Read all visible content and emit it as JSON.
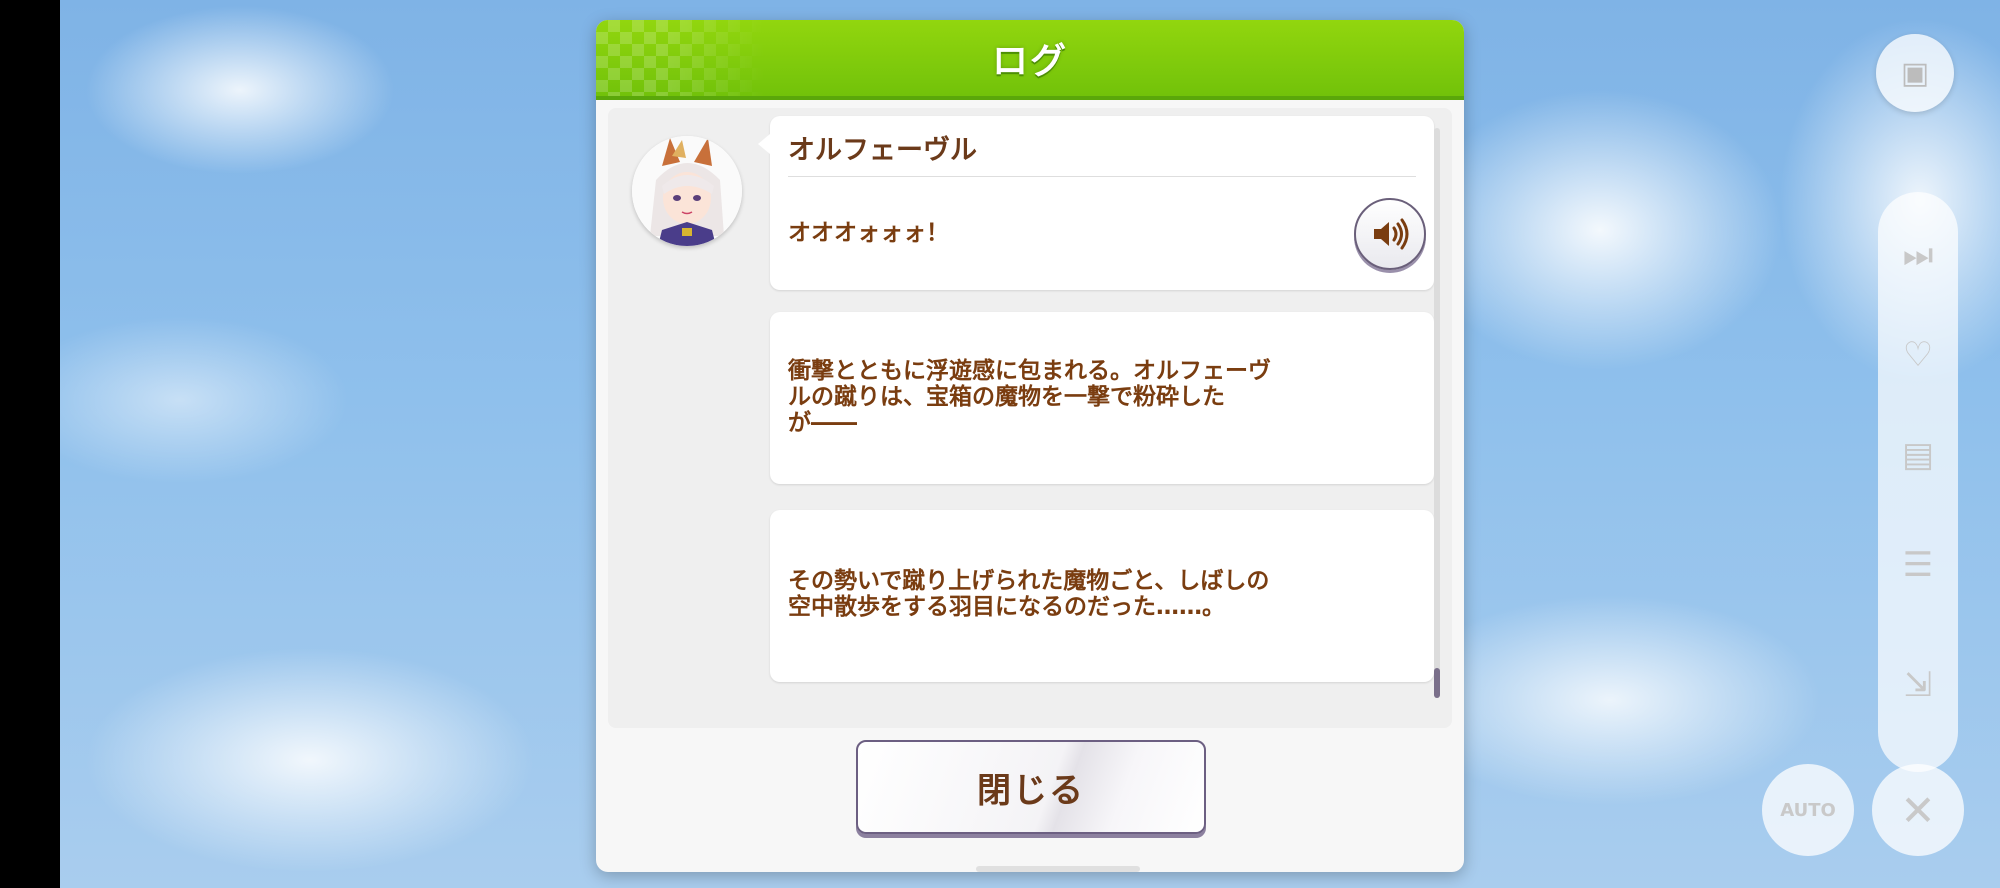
{
  "dialog": {
    "title": "ログ",
    "close_label": "閉じる"
  },
  "entries": [
    {
      "speaker": "オルフェーヴル",
      "text": "オオオォォォ！",
      "has_voice": true
    },
    {
      "speaker": "",
      "text": "衝撃とともに浮遊感に包まれる。オルフェーヴ\nルの蹴りは、宝箱の魔物を一撃で粉砕した\nが――"
    },
    {
      "speaker": "",
      "text": "その勢いで蹴り上げられた魔物ごと、しばしの\n空中散歩をする羽目になるのだった……。"
    }
  ],
  "toolbar": {
    "auto_label": "AUTO"
  },
  "icons": {
    "menu": "photo-icon",
    "skip": "skip-icon",
    "heart": "heart-icon",
    "log": "log-icon",
    "voice": "speaker-icon",
    "close": "close-x-icon"
  },
  "colors": {
    "header_green": "#7ac80b",
    "text_brown": "#7a3d10"
  }
}
